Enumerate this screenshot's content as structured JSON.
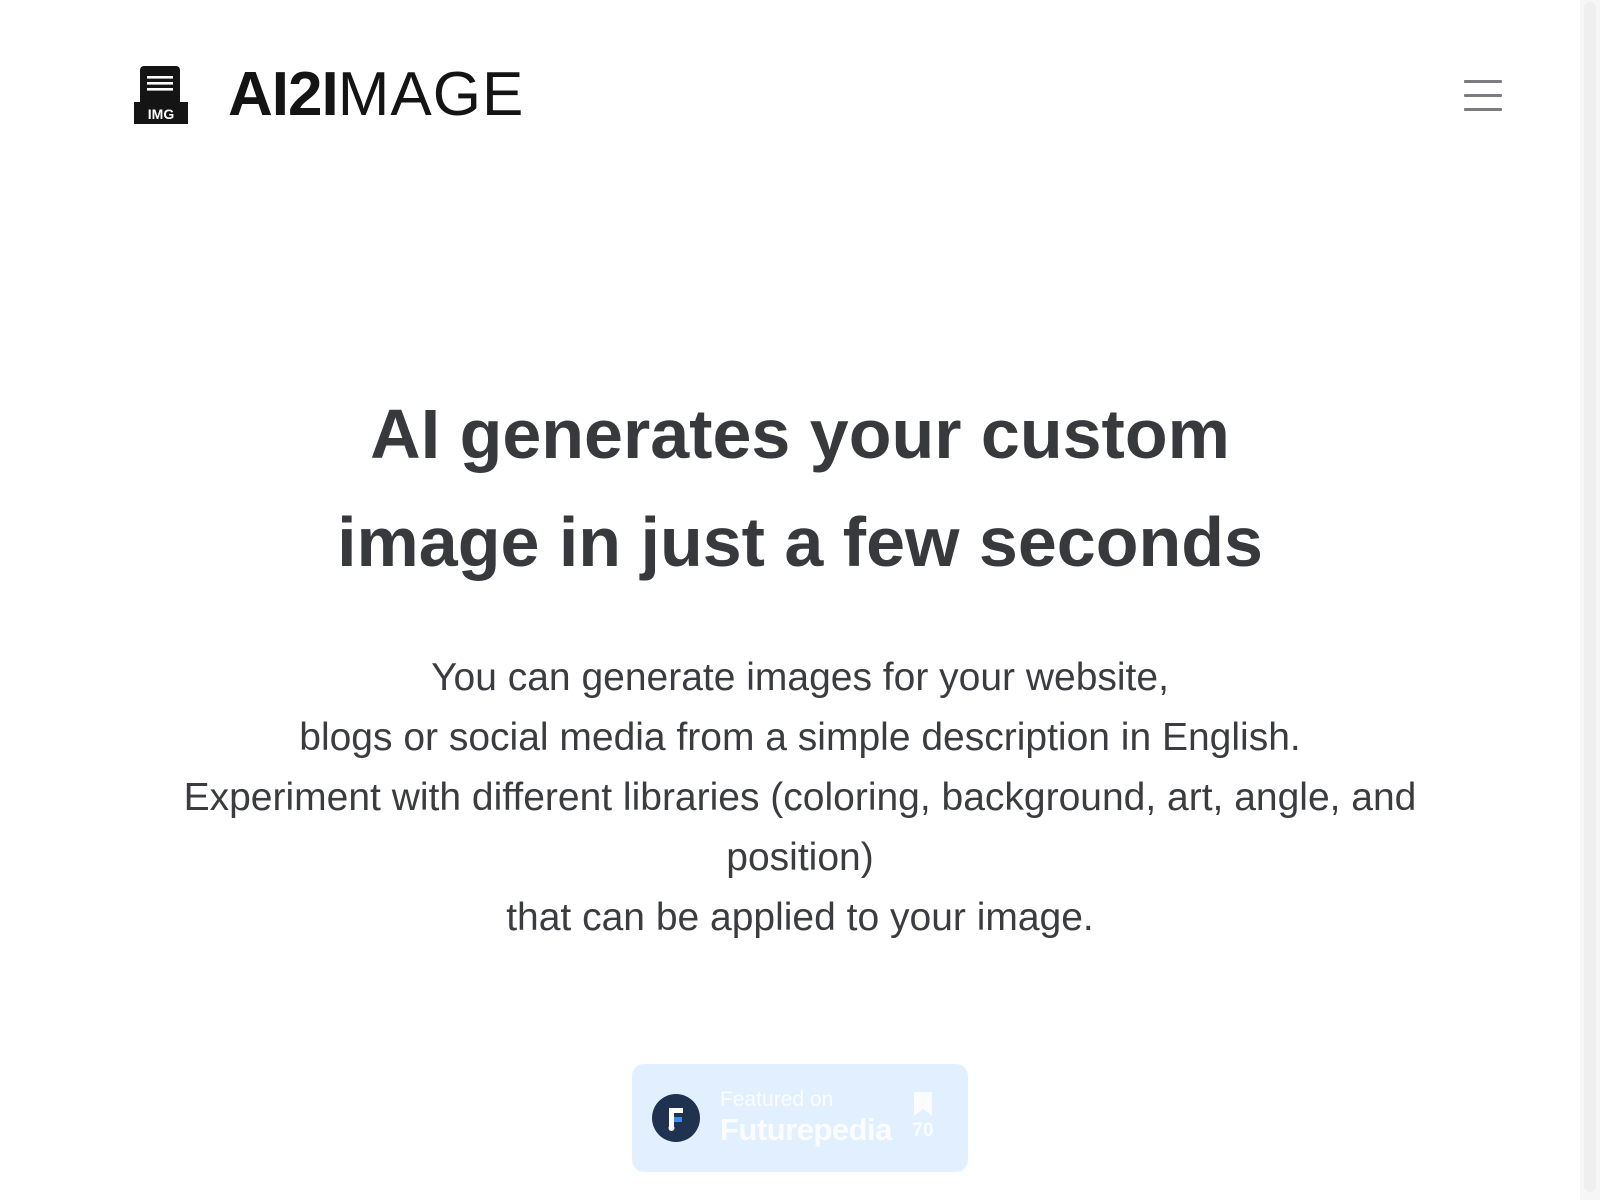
{
  "header": {
    "logo_icon_name": "document-img-icon",
    "logo_icon_label": "IMG",
    "brand_strong": "AI2I",
    "brand_light": "MAGE",
    "menu_icon_name": "hamburger-menu-icon"
  },
  "hero": {
    "title_line1": "AI generates your custom",
    "title_line2": "image in just a few seconds",
    "description_lines": [
      "You can generate images for your website,",
      "blogs or social media from a simple description in English.",
      "Experiment with different libraries (coloring, background, art, angle, and position)",
      "that can be applied to your image."
    ]
  },
  "badge": {
    "kicker": "Featured on",
    "name": "Futurepedia",
    "count": "70",
    "logo_icon_name": "futurepedia-logo-icon",
    "count_icon_name": "bookmark-icon"
  },
  "colors": {
    "text_heading": "#38393d",
    "text_body": "#3b3c40",
    "brand": "#141414",
    "badge_bg": "#e2efff",
    "badge_logo_bg": "#1f3350",
    "menu_icon": "#7c7c80"
  }
}
